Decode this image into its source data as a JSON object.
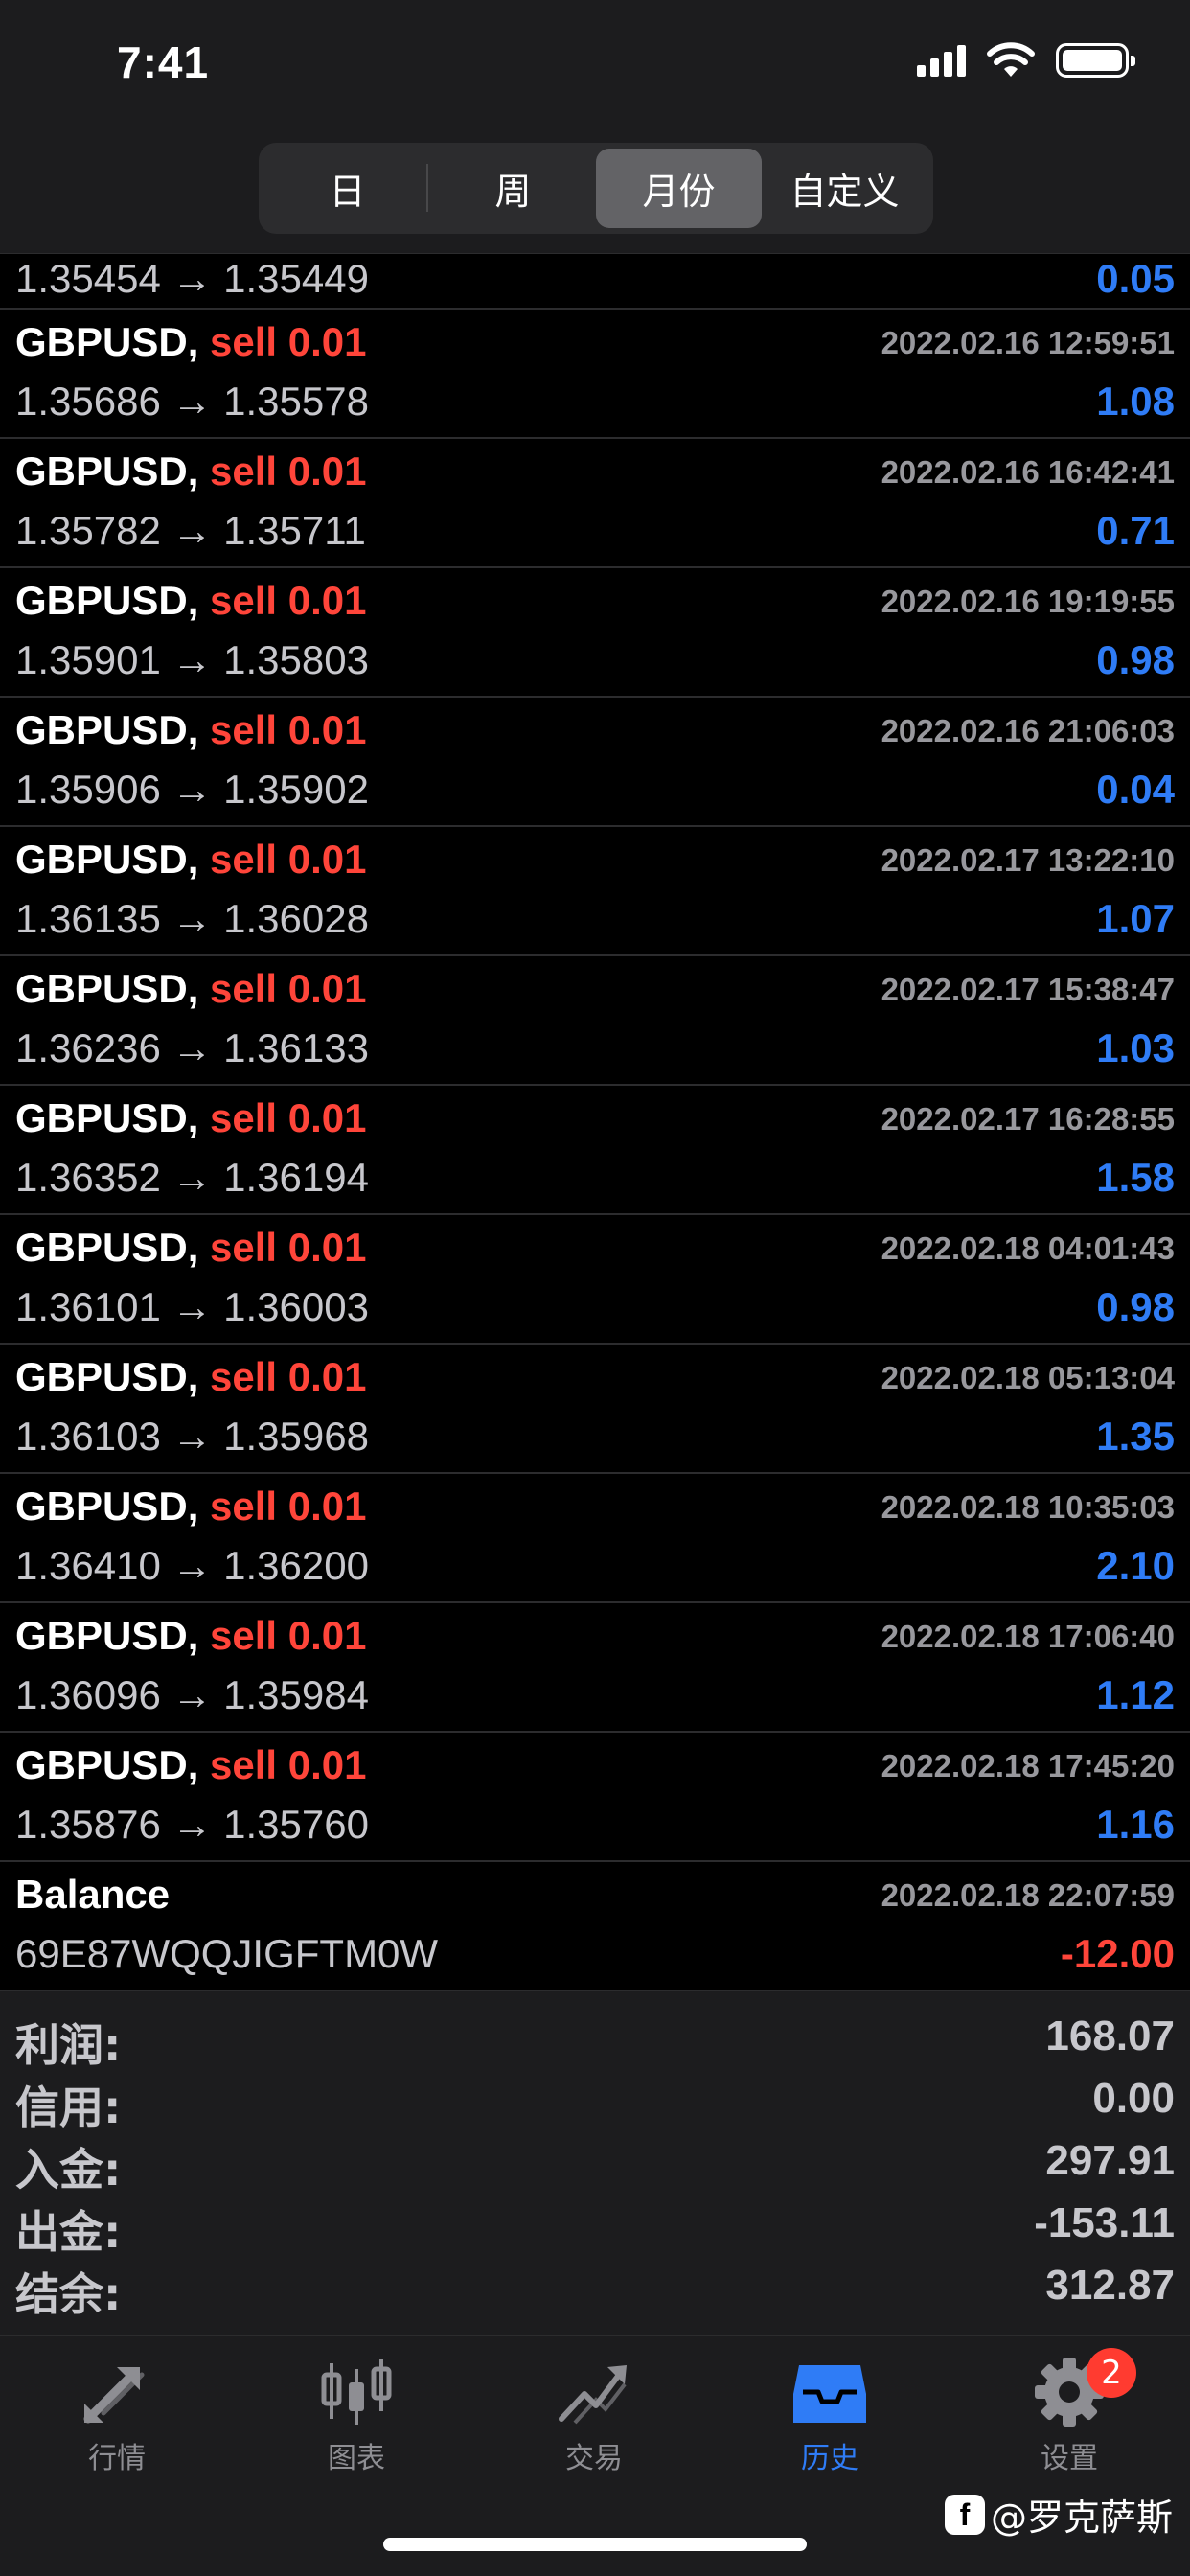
{
  "status_bar": {
    "time": "7:41"
  },
  "period_tabs": [
    {
      "label": "日",
      "active": false
    },
    {
      "label": "周",
      "active": false
    },
    {
      "label": "月份",
      "active": true
    },
    {
      "label": "自定义",
      "active": false
    }
  ],
  "first_row": {
    "prices": "1.35454 → 1.35449",
    "profit": "0.05"
  },
  "trades": [
    {
      "symbol": "GBPUSD,",
      "side": "sell 0.01",
      "datetime": "2022.02.16 12:59:51",
      "prices": "1.35686 → 1.35578",
      "profit": "1.08"
    },
    {
      "symbol": "GBPUSD,",
      "side": "sell 0.01",
      "datetime": "2022.02.16 16:42:41",
      "prices": "1.35782 → 1.35711",
      "profit": "0.71"
    },
    {
      "symbol": "GBPUSD,",
      "side": "sell 0.01",
      "datetime": "2022.02.16 19:19:55",
      "prices": "1.35901 → 1.35803",
      "profit": "0.98"
    },
    {
      "symbol": "GBPUSD,",
      "side": "sell 0.01",
      "datetime": "2022.02.16 21:06:03",
      "prices": "1.35906 → 1.35902",
      "profit": "0.04"
    },
    {
      "symbol": "GBPUSD,",
      "side": "sell 0.01",
      "datetime": "2022.02.17 13:22:10",
      "prices": "1.36135 → 1.36028",
      "profit": "1.07"
    },
    {
      "symbol": "GBPUSD,",
      "side": "sell 0.01",
      "datetime": "2022.02.17 15:38:47",
      "prices": "1.36236 → 1.36133",
      "profit": "1.03"
    },
    {
      "symbol": "GBPUSD,",
      "side": "sell 0.01",
      "datetime": "2022.02.17 16:28:55",
      "prices": "1.36352 → 1.36194",
      "profit": "1.58"
    },
    {
      "symbol": "GBPUSD,",
      "side": "sell 0.01",
      "datetime": "2022.02.18 04:01:43",
      "prices": "1.36101 → 1.36003",
      "profit": "0.98"
    },
    {
      "symbol": "GBPUSD,",
      "side": "sell 0.01",
      "datetime": "2022.02.18 05:13:04",
      "prices": "1.36103 → 1.35968",
      "profit": "1.35"
    },
    {
      "symbol": "GBPUSD,",
      "side": "sell 0.01",
      "datetime": "2022.02.18 10:35:03",
      "prices": "1.36410 → 1.36200",
      "profit": "2.10"
    },
    {
      "symbol": "GBPUSD,",
      "side": "sell 0.01",
      "datetime": "2022.02.18 17:06:40",
      "prices": "1.36096 → 1.35984",
      "profit": "1.12"
    },
    {
      "symbol": "GBPUSD,",
      "side": "sell 0.01",
      "datetime": "2022.02.18 17:45:20",
      "prices": "1.35876 → 1.35760",
      "profit": "1.16"
    }
  ],
  "balance_row": {
    "title": "Balance",
    "datetime": "2022.02.18 22:07:59",
    "comment": "69E87WQQJIGFTM0W",
    "amount": "-12.00"
  },
  "summary": [
    {
      "label": "利润:",
      "value": "168.07"
    },
    {
      "label": "信用:",
      "value": "0.00"
    },
    {
      "label": "入金:",
      "value": "297.91"
    },
    {
      "label": "出金:",
      "value": "-153.11"
    },
    {
      "label": "结余:",
      "value": "312.87"
    }
  ],
  "tab_bar": [
    {
      "label": "行情",
      "icon": "quotes-arrows-icon",
      "active": false
    },
    {
      "label": "图表",
      "icon": "candlestick-chart-icon",
      "active": false
    },
    {
      "label": "交易",
      "icon": "trade-trend-icon",
      "active": false
    },
    {
      "label": "历史",
      "icon": "history-inbox-icon",
      "active": true
    },
    {
      "label": "设置",
      "icon": "gear-icon",
      "active": false,
      "badge": "2"
    }
  ],
  "watermark": {
    "text": "@罗克萨斯"
  },
  "colors": {
    "sell": "#ff453a",
    "profit": "#2f7cf6",
    "active_tab": "#2f7cf6",
    "badge": "#ff3b30"
  }
}
